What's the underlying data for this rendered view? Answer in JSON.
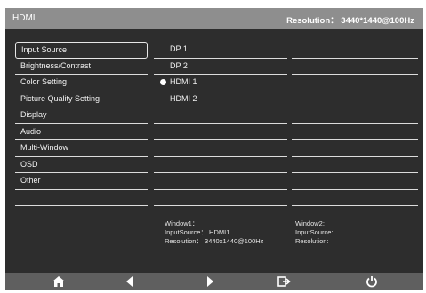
{
  "header": {
    "title": "HDMI",
    "resolution": "Resolution： 3440*1440@100Hz"
  },
  "menu": {
    "items": [
      {
        "label": "Input Source",
        "selected": true
      },
      {
        "label": "Brightness/Contrast"
      },
      {
        "label": "Color Setting"
      },
      {
        "label": "Picture Quality Setting"
      },
      {
        "label": "Display"
      },
      {
        "label": "Audio"
      },
      {
        "label": "Multi-Window"
      },
      {
        "label": "OSD"
      },
      {
        "label": "Other"
      }
    ]
  },
  "submenu": {
    "items": [
      {
        "label": "DP 1"
      },
      {
        "label": "DP 2"
      },
      {
        "label": "HDMI 1",
        "active": true
      },
      {
        "label": "HDMI 2"
      }
    ]
  },
  "info": {
    "window1": {
      "title": "Window1：",
      "input": "InputSource： HDMI1",
      "resolution": "Resolution： 3440x1440@100Hz"
    },
    "window2": {
      "title": "Window2:",
      "input": "InputSource:",
      "resolution": "Resolution:"
    }
  },
  "footer": {
    "buttons": [
      "home-icon",
      "left-arrow-icon",
      "right-arrow-icon",
      "exit-icon",
      "power-icon"
    ]
  },
  "colors": {
    "background": "#2d2d2d",
    "header": "#8e8e8e",
    "footer": "#5f5f5f",
    "text": "#f2f2f2"
  }
}
